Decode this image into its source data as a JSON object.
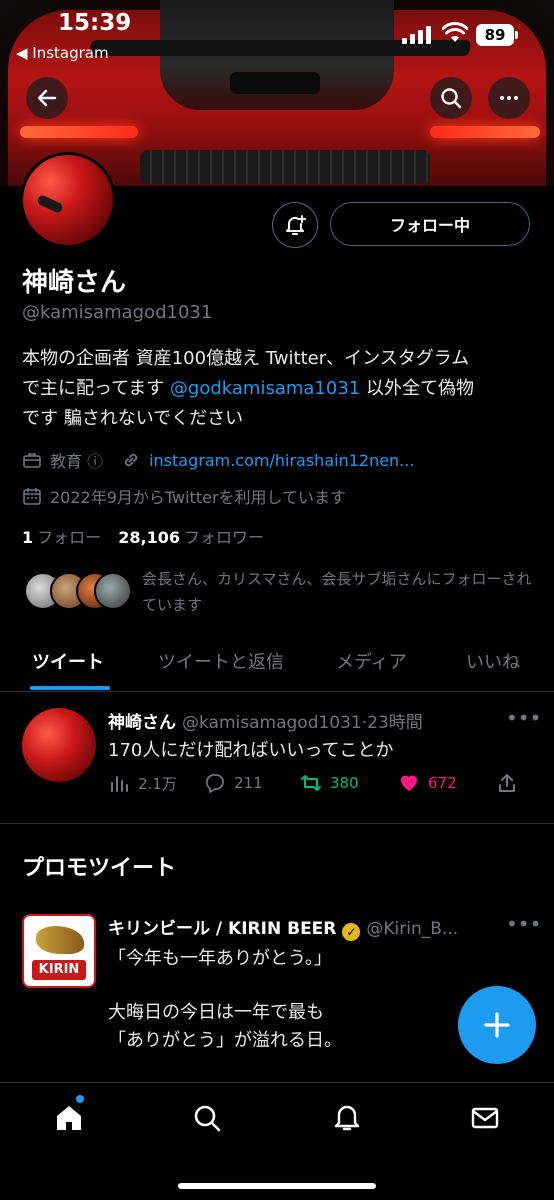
{
  "status_bar": {
    "time": "15:39",
    "back_app": "◀ Instagram",
    "battery": "89"
  },
  "profile": {
    "name": "神崎さん",
    "handle": "@kamisamagod1031",
    "bio_line1": "本物の企画者 資産100億越え Twitter、インスタグラム",
    "bio_line2_pre": "で主に配ってます ",
    "bio_mention": "@godkamisama1031",
    "bio_line2_post": " 以外全て偽物",
    "bio_line3": "です 騙されないでください",
    "category": "教育 ⓘ",
    "link": "instagram.com/hirashain12nen...",
    "joined": "2022年9月からTwitterを利用しています",
    "following_count": "1",
    "following_label": "フォロー",
    "followers_count": "28,106",
    "followers_label": "フォロワー",
    "followed_by_text": "会長さん、カリスマさん、会長サブ垢さんにフォローされています",
    "follow_button": "フォロー中"
  },
  "tabs": [
    {
      "label": "ツイート",
      "active": true
    },
    {
      "label": "ツイートと返信",
      "active": false
    },
    {
      "label": "メディア",
      "active": false
    },
    {
      "label": "いいね",
      "active": false
    }
  ],
  "tweet": {
    "author": "神崎さん",
    "meta": "@kamisamagod1031·23時間",
    "text": "170人にだけ配ればいいってことか",
    "views": "2.1万",
    "replies": "211",
    "retweets": "380",
    "likes": "672"
  },
  "promo": {
    "section_title": "プロモツイート",
    "author": "キリンビール / KIRIN BEER",
    "handle": "@Kirin_B...",
    "logo_text": "KIRIN",
    "line1": "「今年も一年ありがとう。」",
    "line2": "大晦日の今日は一年で最も",
    "line3": "「ありがとう」が溢れる日。"
  },
  "colors": {
    "accent": "#1d9bf0",
    "retweet": "#00ba7c",
    "like": "#f91880",
    "verified": "#e2b719"
  },
  "icons": [
    "back-arrow-icon",
    "search-icon",
    "more-icon",
    "bell-plus-icon",
    "briefcase-icon",
    "link-icon",
    "calendar-icon",
    "views-icon",
    "reply-icon",
    "retweet-icon",
    "heart-icon",
    "share-icon",
    "compose-plus-icon",
    "home-icon",
    "search-nav-icon",
    "notifications-icon",
    "messages-icon"
  ]
}
